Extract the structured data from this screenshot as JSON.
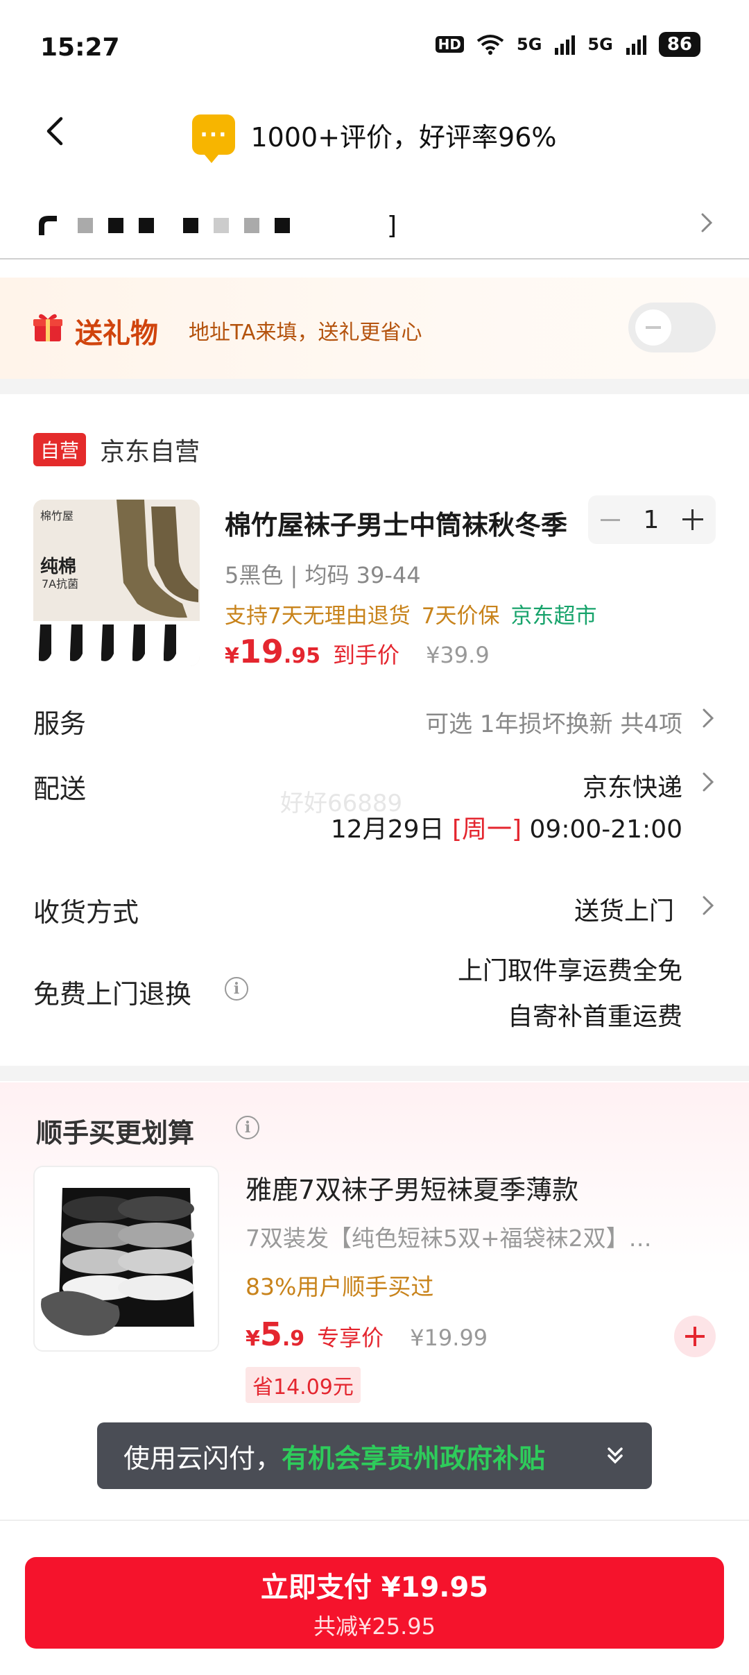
{
  "status_bar": {
    "time": "15:27",
    "hd": "HD",
    "signal_a": "5G",
    "signal_b": "5G",
    "battery": "86"
  },
  "header": {
    "review_text": "1000+评价，好评率96%",
    "bubble_icon": "message-bubble-icon",
    "accent": "#f7b500"
  },
  "gift": {
    "title": "送礼物",
    "desc": "地址TA来填，送礼更省心",
    "toggle_on": false
  },
  "shop": {
    "badge": "自营",
    "name": "京东自营"
  },
  "product": {
    "image_brand": "棉竹屋",
    "image_label": "纯棉",
    "image_sublabel": "7A抗菌",
    "title": "棉竹屋袜子男士中筒袜秋冬季",
    "spec": "5黑色 | 均码 39-44",
    "tag_return": "支持7天无理由退货",
    "tag_price_protect": "7天价保",
    "tag_market": "京东超市",
    "price_symbol": "¥",
    "price_int": "19",
    "price_dec": ".95",
    "price_label": "到手价",
    "price_orig": "¥39.9",
    "quantity": "1"
  },
  "service": {
    "label": "服务",
    "value": "可选 1年损坏换新 共4项"
  },
  "delivery": {
    "label": "配送",
    "carrier": "京东快递",
    "date": "12月29日",
    "weekday": "[周一]",
    "time": "09:00-21:00",
    "watermark": "好好66889"
  },
  "receive": {
    "label": "收货方式",
    "value": "送货上门"
  },
  "free_return": {
    "label": "免费上门退换",
    "line1": "上门取件享运费全免",
    "line2": "自寄补首重运费"
  },
  "bundle": {
    "title": "顺手买更划算",
    "name": "雅鹿7双袜子男短袜夏季薄款",
    "desc": "7双装发【纯色短袜5双+福袋袜2双】…",
    "bought": "83%用户顺手买过",
    "price_symbol": "¥",
    "price_int": "5",
    "price_dec": ".9",
    "price_label": "专享价",
    "price_orig": "¥19.99",
    "save": "省14.09元"
  },
  "toast": {
    "lead": "使用云闪付，",
    "highlight": "有机会享贵州政府补贴"
  },
  "pay": {
    "main": "立即支付 ¥19.95",
    "sub": "共减¥25.95",
    "color": "#f5132c"
  }
}
